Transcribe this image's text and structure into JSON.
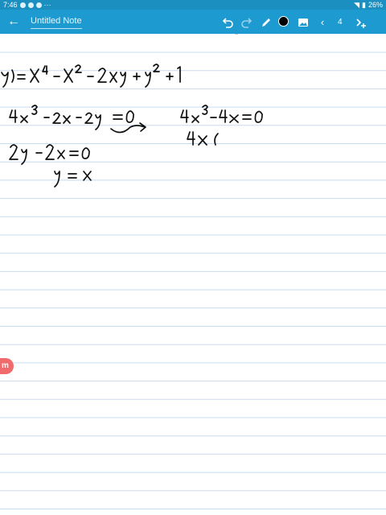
{
  "status_bar": {
    "time": "7:46",
    "battery": "26%",
    "icons": [
      "notification-icon",
      "notification-icon",
      "notification-icon",
      "more-dots-icon"
    ]
  },
  "app_bar": {
    "back_icon": "arrow-left-icon",
    "title": "Untitled Note",
    "undo_icon": "undo-icon",
    "redo_icon": "redo-icon",
    "pen_icon": "pen-icon",
    "color": "#000000",
    "image_icon": "image-icon",
    "prev_icon": "chevron-left-icon",
    "page_number": "4",
    "next_icon": "add-page-icon",
    "accent": "#1d9ad0"
  },
  "note": {
    "paper_color": "#ffffff",
    "rule_color": "#c9dcef",
    "handwriting": [
      "y) = x⁴ - x² - 2xy + y² + 1",
      "4x³ - 2x - 2y = 0",
      "4x³ - 4x = 0",
      "4x (",
      "2y - 2x = 0",
      "y = x"
    ]
  },
  "badge": {
    "label": "m",
    "color": "#f06b6b"
  }
}
